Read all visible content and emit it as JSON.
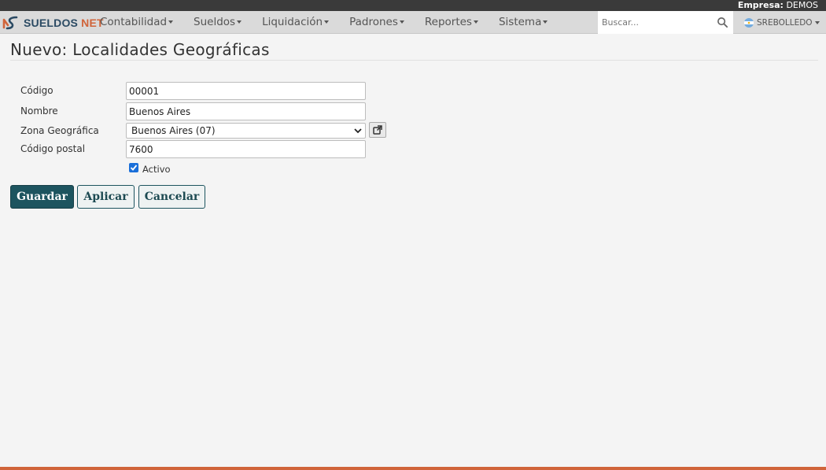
{
  "topbar": {
    "empresa_label": "Empresa:",
    "empresa_value": "DEMOS"
  },
  "brand": {
    "name_part1": "SUELDOS",
    "name_part2": "NET"
  },
  "menu": [
    {
      "label": "Contabilidad"
    },
    {
      "label": "Sueldos"
    },
    {
      "label": "Liquidación"
    },
    {
      "label": "Padrones"
    },
    {
      "label": "Reportes"
    },
    {
      "label": "Sistema"
    }
  ],
  "search": {
    "placeholder": "Buscar..."
  },
  "user": {
    "name": "SREBOLLEDO"
  },
  "page": {
    "title": "Nuevo: Localidades Geográficas"
  },
  "form": {
    "codigo": {
      "label": "Código",
      "value": "00001"
    },
    "nombre": {
      "label": "Nombre",
      "value": "Buenos Aires"
    },
    "zona": {
      "label": "Zona Geográfica",
      "value": "Buenos Aires (07)"
    },
    "codigo_postal": {
      "label": "Código postal",
      "value": "7600"
    },
    "activo": {
      "label": "Activo",
      "checked": true
    }
  },
  "buttons": {
    "guardar": "Guardar",
    "aplicar": "Aplicar",
    "cancelar": "Cancelar"
  },
  "colors": {
    "brand_dark": "#2b4a63",
    "brand_accent": "#d0643a",
    "primary": "#1d545f"
  }
}
